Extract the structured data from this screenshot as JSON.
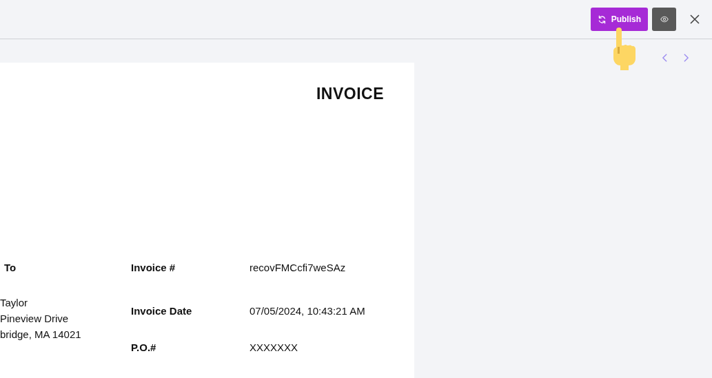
{
  "toolbar": {
    "publish_button": "Publish"
  },
  "invoice": {
    "title": "INVOICE",
    "bill_to": {
      "heading": "To",
      "lines": [
        "Taylor",
        "Pineview Drive",
        "bridge, MA 14021"
      ]
    },
    "fields": [
      {
        "label": "Invoice #",
        "value": "recovFMCcfi7weSAz"
      },
      {
        "label": "Invoice Date",
        "value": "07/05/2024, 10:43:21 AM"
      },
      {
        "label": "P.O.#",
        "value": "XXXXXXX"
      }
    ]
  }
}
